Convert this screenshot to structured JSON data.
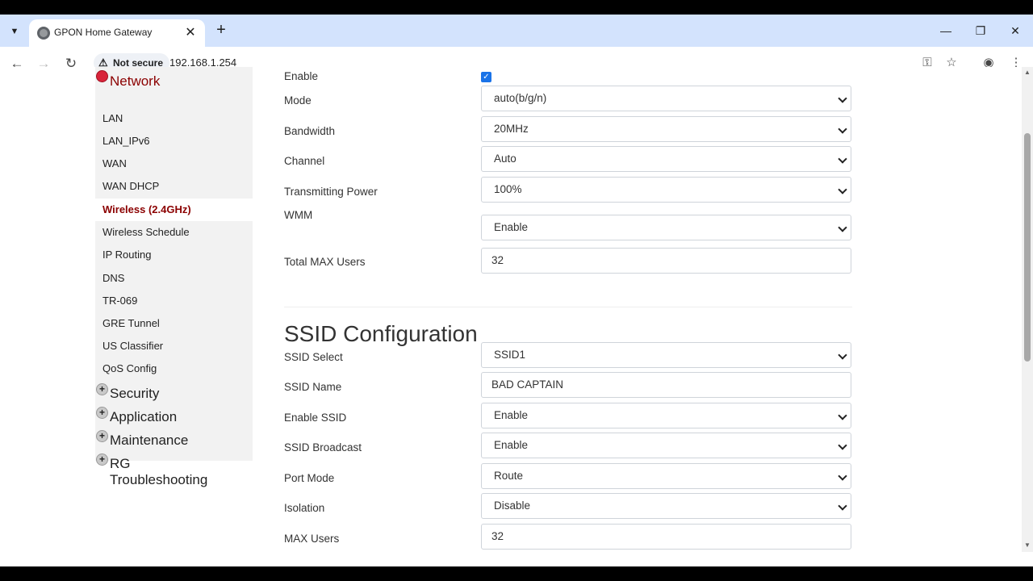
{
  "browser": {
    "tab_title": "GPON Home Gateway",
    "tab_close": "✕",
    "new_tab": "+",
    "security_label": "Not secure",
    "url": "192.168.1.254",
    "minimize": "—",
    "restore": "❐",
    "close": "✕"
  },
  "sidebar": {
    "network": "Network",
    "items": [
      "LAN",
      "LAN_IPv6",
      "WAN",
      "WAN DHCP",
      "Wireless (2.4GHz)",
      "Wireless Schedule",
      "IP Routing",
      "DNS",
      "TR-069",
      "GRE Tunnel",
      "US Classifier",
      "QoS Config"
    ],
    "selected_index": 4,
    "groups": [
      "Security",
      "Application",
      "Maintenance",
      "RG Troubleshooting"
    ]
  },
  "basic": {
    "enable_label": "Enable",
    "enable_checked": true,
    "mode_label": "Mode",
    "mode_value": "auto(b/g/n)",
    "bandwidth_label": "Bandwidth",
    "bandwidth_value": "20MHz",
    "channel_label": "Channel",
    "channel_value": "Auto",
    "power_label": "Transmitting Power",
    "power_value": "100%",
    "wmm_label": "WMM",
    "wmm_value": "Enable",
    "total_users_label": "Total MAX Users",
    "total_users_value": "32"
  },
  "ssid": {
    "title": "SSID Configuration",
    "select_label": "SSID Select",
    "select_value": "SSID1",
    "name_label": "SSID Name",
    "name_value": "BAD CAPTAIN",
    "enable_label": "Enable SSID",
    "enable_value": "Enable",
    "broadcast_label": "SSID Broadcast",
    "broadcast_value": "Enable",
    "port_mode_label": "Port Mode",
    "port_mode_value": "Route",
    "isolation_label": "Isolation",
    "isolation_value": "Disable",
    "max_users_label": "MAX Users",
    "max_users_value": "32"
  }
}
